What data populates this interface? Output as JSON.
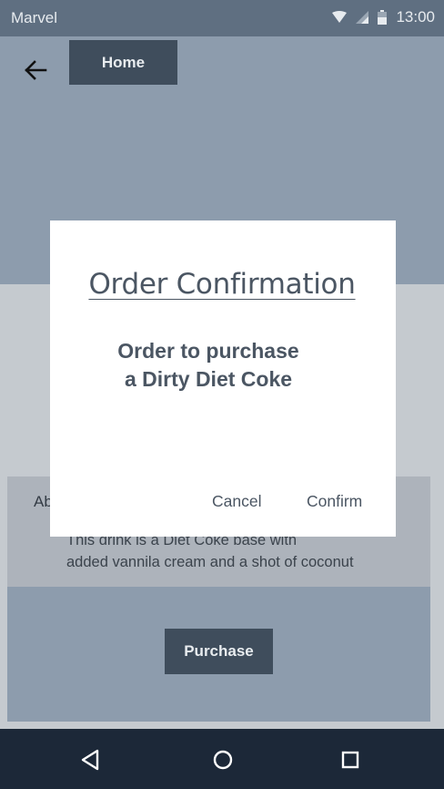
{
  "status_bar": {
    "carrier": "Marvel",
    "time": "13:00"
  },
  "header": {
    "home_label": "Home"
  },
  "about": {
    "title": "About",
    "description_line1": "This drink is a Diet Coke base with",
    "description_line2": "added vannila cream and a shot of coconut"
  },
  "purchase": {
    "label": "Purchase"
  },
  "dialog": {
    "title": "Order Confirmation",
    "message_line1": "Order to purchase",
    "message_line2": "a Dirty Diet Coke",
    "cancel_label": "Cancel",
    "confirm_label": "Confirm"
  },
  "icons": {
    "back": "arrow-left-icon",
    "wifi": "wifi-icon",
    "signal": "signal-icon",
    "battery": "battery-icon",
    "nav_back": "triangle-back-icon",
    "nav_home": "circle-home-icon",
    "nav_recents": "square-recents-icon"
  },
  "colors": {
    "status_bar": "#5f6f81",
    "header_bg": "#8d9cad",
    "button_bg": "#3f4d5c",
    "nav_bar": "#1c2838",
    "dialog_bg": "#ffffff",
    "dialog_text": "#4b5663"
  }
}
